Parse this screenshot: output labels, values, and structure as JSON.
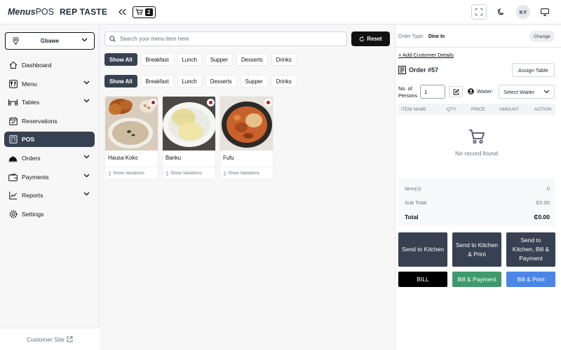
{
  "header": {
    "logo_bold": "Menus",
    "logo_light": "POS",
    "restaurant": "REP TASTE",
    "cart_count": "2",
    "avatar": "KY"
  },
  "sidebar": {
    "branch": "Gbawe",
    "items": [
      {
        "label": "Dashboard"
      },
      {
        "label": "Menu"
      },
      {
        "label": "Tables"
      },
      {
        "label": "Reservations"
      },
      {
        "label": "POS"
      },
      {
        "label": "Orders"
      },
      {
        "label": "Payments"
      },
      {
        "label": "Reports"
      },
      {
        "label": "Settings"
      }
    ],
    "customer_site": "Customer Site"
  },
  "main": {
    "search_placeholder": "Search your menu item here",
    "reset_label": "Reset",
    "filters1": [
      "Show All",
      "Breakfast",
      "Lunch",
      "Supper",
      "Desserts",
      "Drinks"
    ],
    "filters2": [
      "Show All",
      "Breakfast",
      "Lunch",
      "Desserts",
      "Supper",
      "Drinks"
    ],
    "items": [
      {
        "name": "Hausa Koko",
        "variations": "Show Variations"
      },
      {
        "name": "Banku",
        "variations": "Show Variations"
      },
      {
        "name": "Fufu",
        "variations": "Show Variations"
      }
    ]
  },
  "order": {
    "type_label": "Order Type:",
    "type_value": "Dine In",
    "change_label": "Change",
    "add_customer": "+ Add Customer Details",
    "order_number": "Order #57",
    "assign_table": "Assign Table",
    "persons_label_1": "No. of",
    "persons_label_2": "Persons",
    "persons_value": "1",
    "waiter_label": "Waiter:",
    "waiter_value": "Select Waiter",
    "columns": [
      "ITEM NAME",
      "QTY",
      "PRICE",
      "AMOUNT",
      "ACTION"
    ],
    "empty_text": "No record found",
    "items_label": "Item(s)",
    "items_value": "0",
    "subtotal_label": "Sub Total",
    "subtotal_value": "₵0.00",
    "total_label": "Total",
    "total_value": "₵0.00",
    "btn_send_kitchen": "Send to Kitchen",
    "btn_send_kitchen_print": "Send to Kitchen & Print",
    "btn_send_kitchen_bill_payment": "Send to Kitchen, Bill & Payment",
    "btn_bill": "BILL",
    "btn_bill_payment": "Bill & Payment",
    "btn_bill_print": "Bill & Print"
  },
  "colors": {
    "dark": "#374151",
    "black": "#111111",
    "green": "#3f9a6b",
    "blue": "#4a86e8"
  }
}
